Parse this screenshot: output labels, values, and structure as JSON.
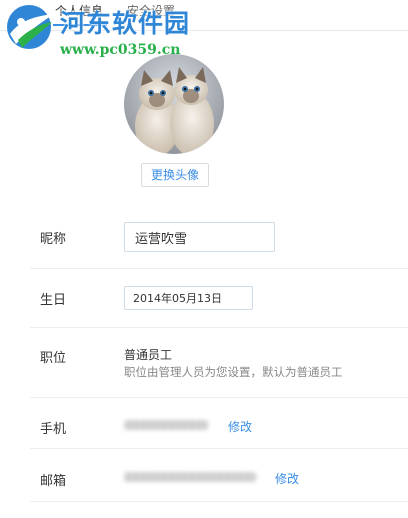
{
  "tabs": [
    {
      "label": "个人信息",
      "active": true
    },
    {
      "label": "安全设置",
      "active": false
    }
  ],
  "watermark": {
    "title": "河东软件园",
    "url": "www.pc0359.cn"
  },
  "avatar": {
    "change_button": "更换头像"
  },
  "profile": {
    "nickname": {
      "label": "昵称",
      "value": "运营吹雪"
    },
    "birthday": {
      "label": "生日",
      "value": "2014年05月13日"
    },
    "position": {
      "label": "职位",
      "value": "普通员工",
      "note": "职位由管理人员为您设置，默认为普通员工"
    },
    "phone": {
      "label": "手机",
      "modify": "修改"
    },
    "email": {
      "label": "邮箱",
      "modify": "修改"
    }
  },
  "colors": {
    "accent": "#3a8ee6",
    "watermark_blue": "#2f86d6",
    "watermark_green": "#28b04a",
    "divider": "#eeeeee"
  }
}
